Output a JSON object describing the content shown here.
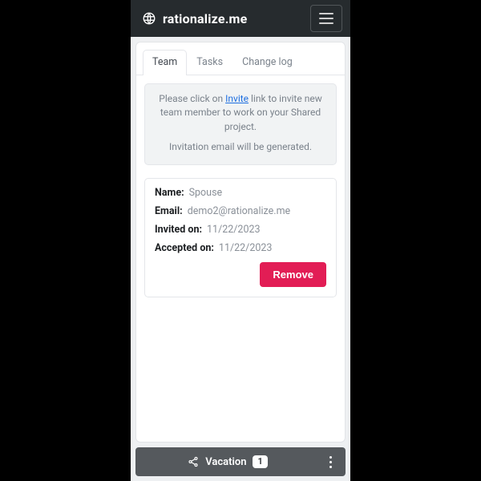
{
  "brand": {
    "name": "rationalize.me"
  },
  "tabs": {
    "team": "Team",
    "tasks": "Tasks",
    "changelog": "Change log"
  },
  "notice": {
    "pre": "Please click on ",
    "link": "Invite",
    "post": " link to invite new team member to work on your Shared project.",
    "line2": "Invitation email will be generated."
  },
  "labels": {
    "name": "Name:",
    "email": "Email:",
    "invited": "Invited on:",
    "accepted": "Accepted on:"
  },
  "member": {
    "name": "Spouse",
    "email": "demo2@rationalize.me",
    "invited_on": "11/22/2023",
    "accepted_on": "11/22/2023"
  },
  "buttons": {
    "remove": "Remove"
  },
  "bottombar": {
    "project": "Vacation",
    "count": "1"
  }
}
